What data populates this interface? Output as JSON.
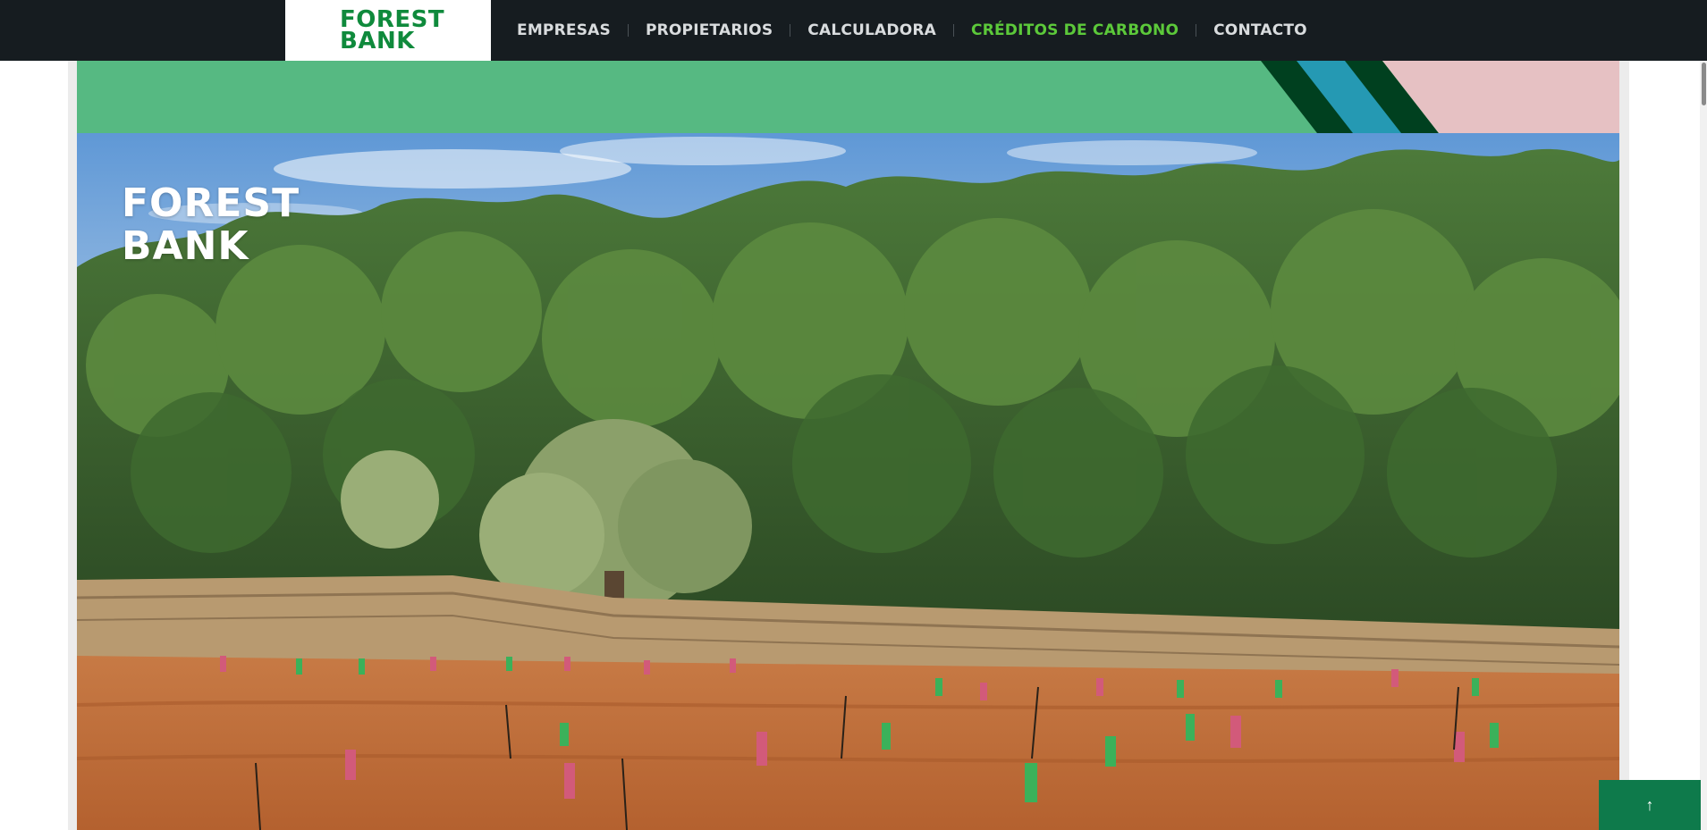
{
  "header": {
    "logo": {
      "line1": "FOREST",
      "line2": "BANK"
    },
    "nav": [
      {
        "label": "EMPRESAS",
        "active": false
      },
      {
        "label": "PROPIETARIOS",
        "active": false
      },
      {
        "label": "CALCULADORA",
        "active": false
      },
      {
        "label": "CRÉDITOS DE CARBONO",
        "active": true
      },
      {
        "label": "CONTACTO",
        "active": false
      }
    ]
  },
  "hero": {
    "logo": {
      "line1": "FOREST",
      "line2": "BANK"
    },
    "image_description": "forest-hillside-with-planted-saplings"
  },
  "scroll_top": {
    "icon": "arrow-up-icon",
    "glyph": "↑"
  },
  "colors": {
    "nav_bg": "#161c20",
    "nav_active": "#5cc93a",
    "brand_green": "#0f8a3c",
    "banner_green": "#56b982",
    "stripe_dark": "#00401f",
    "stripe_teal": "#2599b3",
    "stripe_pink": "#e6c1c3",
    "button_green": "#0e7a4b"
  }
}
